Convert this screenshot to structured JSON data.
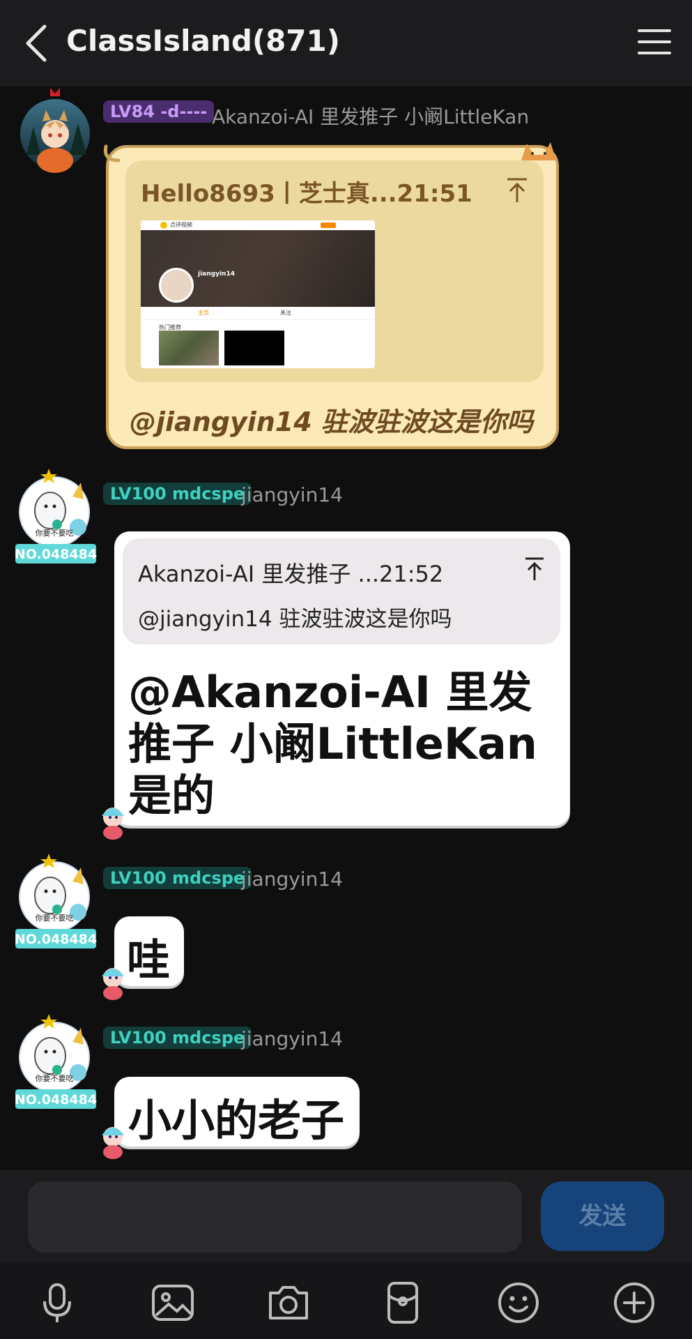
{
  "header": {
    "title": "ClassIsland(871)"
  },
  "messages": [
    {
      "level_badge": "LV84 -d----",
      "sender": "Akanzoi-AI 里发推子 小阚LittleKan",
      "quote_header": "Hello8693丨芝士真...21:51",
      "quote_thumb": {
        "site_name": "点评视频",
        "profile_name": "jiangyin14",
        "tab_home": "主页",
        "tab_fans": "关注",
        "section_label": "热门推荐"
      },
      "text": "@jiangyin14 驻波驻波这是你吗"
    },
    {
      "level_badge": "LV100 mdcspe",
      "sender": "jiangyin14",
      "avatar_caption": "你要不要吃",
      "avatar_number": "NO.048484",
      "quote_header": "Akanzoi-AI 里发推子 ...21:52",
      "quote_body": "@jiangyin14 驻波驻波这是你吗",
      "text": "@Akanzoi-AI 里发推子 小阚LittleKan  是的"
    },
    {
      "level_badge": "LV100 mdcspe",
      "sender": "jiangyin14",
      "avatar_caption": "你要不要吃",
      "avatar_number": "NO.048484",
      "text": "哇"
    },
    {
      "level_badge": "LV100 mdcspe",
      "sender": "jiangyin14",
      "avatar_caption": "你要不要吃",
      "avatar_number": "NO.048484",
      "text": "小小的老子"
    }
  ],
  "input": {
    "placeholder": "",
    "send_label": "发送"
  },
  "toolbar_icons": [
    "microphone-icon",
    "image-icon",
    "camera-icon",
    "red-packet-icon",
    "emoji-icon",
    "plus-icon"
  ],
  "colors": {
    "background": "#0f0f0f",
    "send_button": "#16437a",
    "cat_bubble": "#fbe9b7",
    "teal_badge": "#3fd1c0",
    "purple_badge": "#c99af7"
  }
}
